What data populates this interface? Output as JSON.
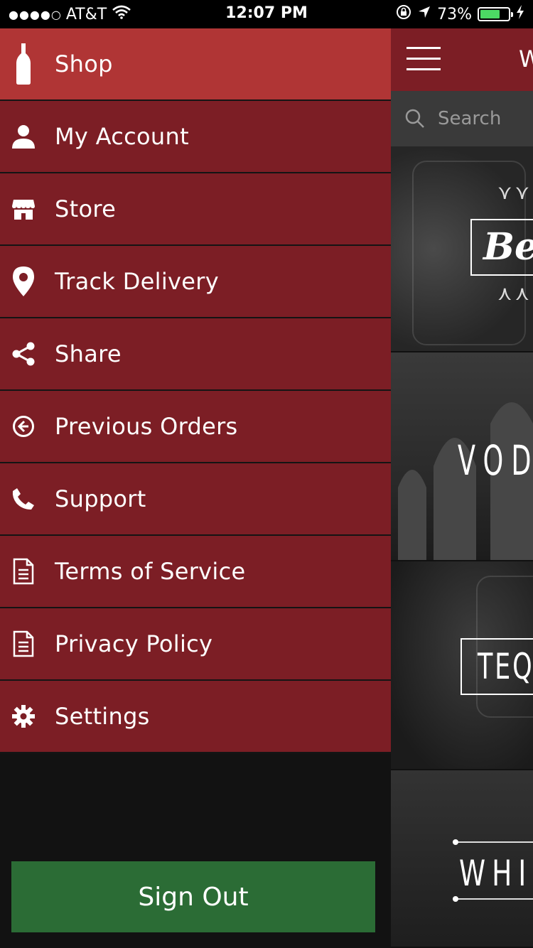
{
  "status_bar": {
    "signal_dots": "●●●●○",
    "carrier": "AT&T",
    "time": "12:07 PM",
    "battery_percent": "73%",
    "battery_level": 0.73,
    "battery_color": "#4cd964"
  },
  "drawer": {
    "items": [
      {
        "label": "Shop",
        "icon": "bottle-icon",
        "active": true
      },
      {
        "label": "My Account",
        "icon": "user-icon"
      },
      {
        "label": "Store",
        "icon": "store-icon"
      },
      {
        "label": "Track Delivery",
        "icon": "location-pin-icon"
      },
      {
        "label": "Share",
        "icon": "share-icon"
      },
      {
        "label": "Previous Orders",
        "icon": "circle-arrow-left-icon"
      },
      {
        "label": "Support",
        "icon": "phone-icon"
      },
      {
        "label": "Terms of Service",
        "icon": "document-icon"
      },
      {
        "label": "Privacy Policy",
        "icon": "document-icon"
      },
      {
        "label": "Settings",
        "icon": "gear-icon"
      }
    ],
    "sign_out_label": "Sign Out"
  },
  "main": {
    "header_title": "W",
    "search": {
      "placeholder": "Search"
    },
    "categories": [
      {
        "label": "Be"
      },
      {
        "label": "VOD"
      },
      {
        "label": "TEQU"
      },
      {
        "label": "WHIS"
      }
    ]
  },
  "colors": {
    "menu_bg": "#7c1e25",
    "menu_active_bg": "#b03535",
    "sign_out_bg": "#2b6c35",
    "search_bg": "#3a3a3a"
  }
}
